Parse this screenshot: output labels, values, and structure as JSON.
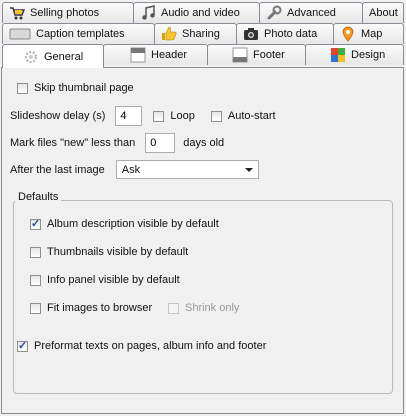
{
  "tabs": {
    "row1": [
      {
        "label": "Selling photos",
        "icon": "cart-icon"
      },
      {
        "label": "Audio and video",
        "icon": "music-note-icon"
      },
      {
        "label": "Advanced",
        "icon": "wrench-icon"
      },
      {
        "label": "About",
        "icon": ""
      }
    ],
    "row2": [
      {
        "label": "Caption templates",
        "icon": "caption-icon"
      },
      {
        "label": "Sharing",
        "icon": "thumbs-up-icon"
      },
      {
        "label": "Photo data",
        "icon": "camera-icon"
      },
      {
        "label": "Map",
        "icon": "map-pin-icon"
      }
    ],
    "row3": [
      {
        "label": "General",
        "icon": "gear-icon",
        "active": true
      },
      {
        "label": "Header",
        "icon": "header-icon"
      },
      {
        "label": "Footer",
        "icon": "footer-icon"
      },
      {
        "label": "Design",
        "icon": "palette-icon"
      }
    ]
  },
  "general": {
    "skip_thumbnail_page": {
      "label": "Skip thumbnail page",
      "checked": false
    },
    "slideshow_delay": {
      "label": "Slideshow delay (s)",
      "value": "4"
    },
    "loop": {
      "label": "Loop",
      "checked": false
    },
    "auto_start": {
      "label": "Auto-start",
      "checked": false
    },
    "mark_new": {
      "label": "Mark files \"new\" less than",
      "value": "0",
      "suffix": "days old"
    },
    "after_last_image": {
      "label": "After the last image",
      "selected": "Ask"
    },
    "defaults": {
      "title": "Defaults",
      "album_description": {
        "label": "Album description visible by default",
        "checked": true
      },
      "thumbnails_visible": {
        "label": "Thumbnails visible by default",
        "checked": false
      },
      "info_panel": {
        "label": "Info panel visible by default",
        "checked": false
      },
      "fit_images": {
        "label": "Fit images to browser",
        "checked": false
      },
      "shrink_only": {
        "label": "Shrink only",
        "checked": false,
        "disabled": true
      }
    },
    "preformat": {
      "label": "Preformat texts on pages, album info and footer",
      "checked": true
    }
  }
}
